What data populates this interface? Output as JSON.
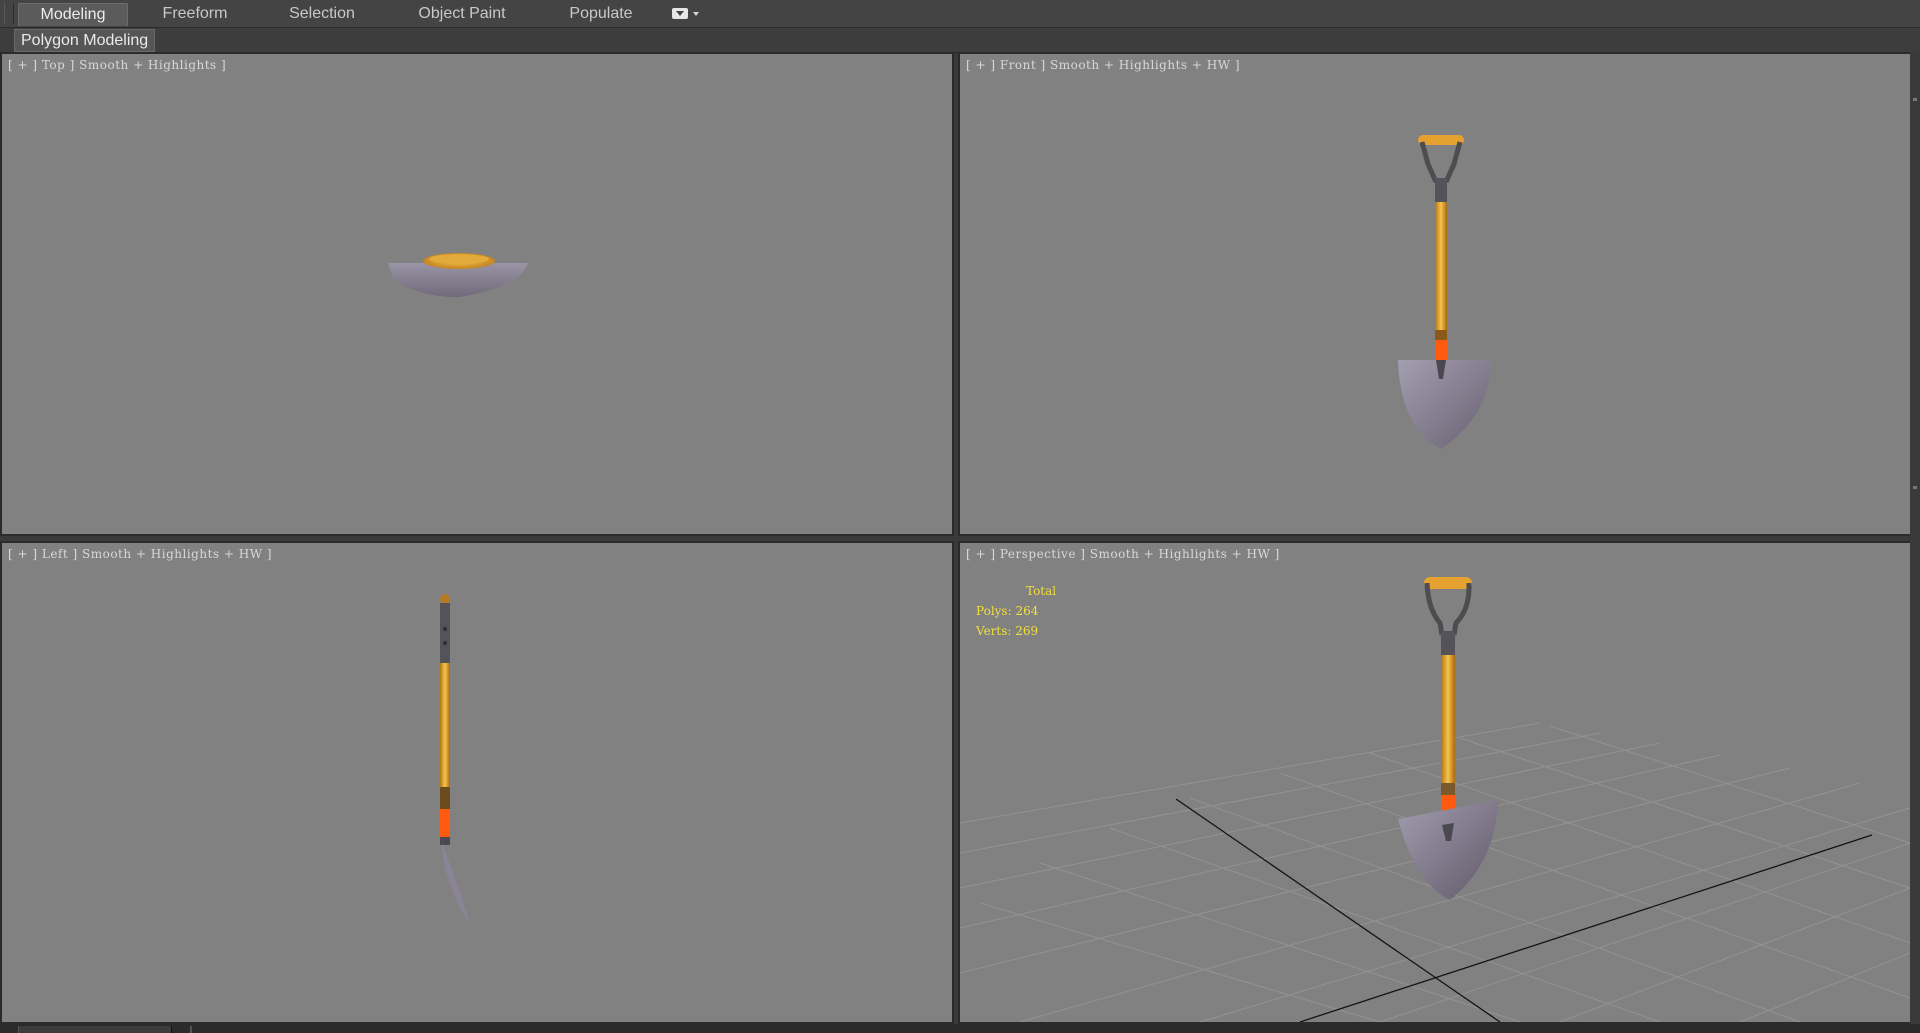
{
  "ribbon": {
    "tabs": [
      {
        "label": "Modeling",
        "active": true
      },
      {
        "label": "Freeform",
        "active": false
      },
      {
        "label": "Selection",
        "active": false
      },
      {
        "label": "Object Paint",
        "active": false
      },
      {
        "label": "Populate",
        "active": false
      }
    ],
    "panel_label": "Polygon Modeling"
  },
  "viewports": {
    "top": {
      "label": "[ + ] Top ] Smooth + Highlights ]"
    },
    "front": {
      "label": "[ + ] Front ] Smooth + Highlights + HW ]"
    },
    "left": {
      "label": "[ + ] Left ] Smooth + Highlights + HW ]"
    },
    "perspective": {
      "label": "[ + ] Perspective ] Smooth + Highlights + HW ]",
      "stats": {
        "title": "Total",
        "polys": "Polys: 264",
        "verts": "Verts: 269"
      }
    }
  },
  "colors": {
    "viewport_bg": "#818181",
    "stats_text": "#f2df3a",
    "handle_wood": "#e0a12c",
    "grip_orange": "#ff5a10",
    "blade_metal": "#8a8496"
  }
}
